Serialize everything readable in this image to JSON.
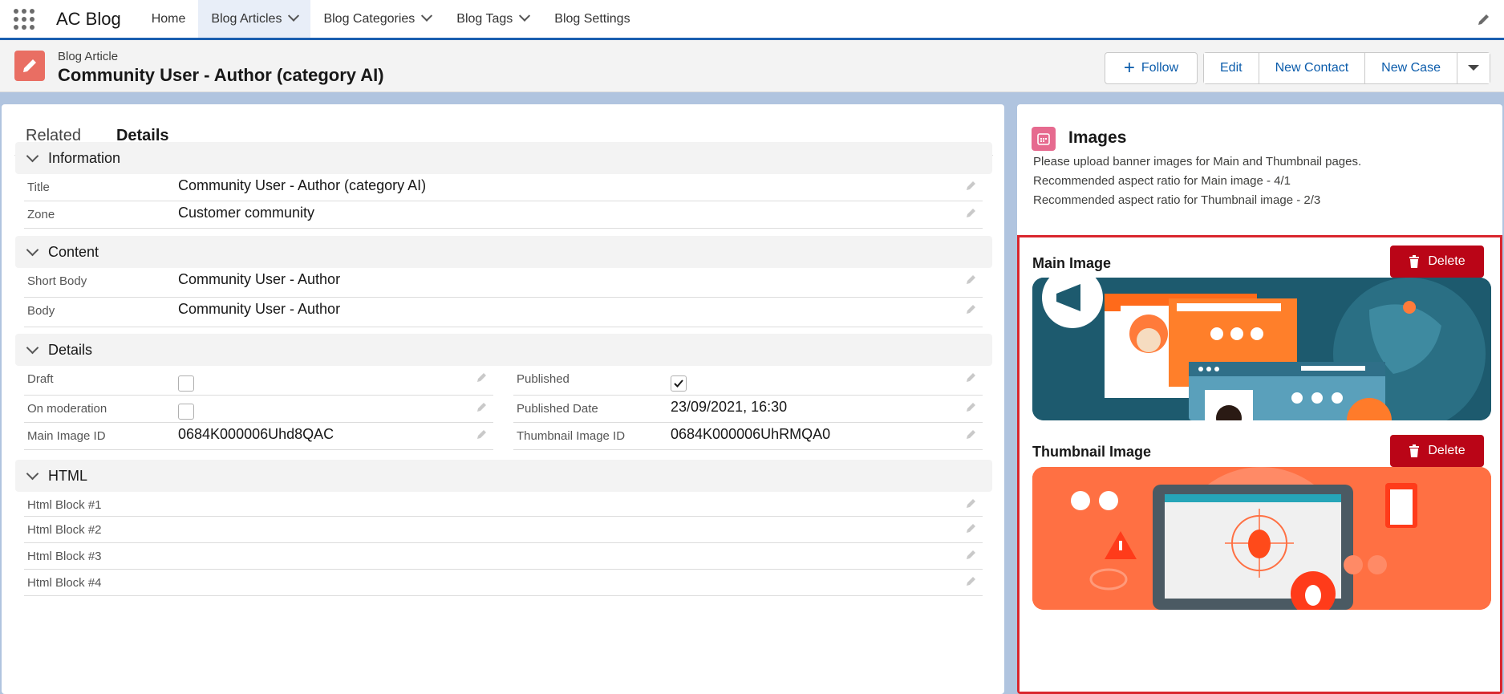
{
  "nav": {
    "app_name": "AC Blog",
    "items": [
      {
        "label": "Home",
        "has_dropdown": false,
        "active": false
      },
      {
        "label": "Blog Articles",
        "has_dropdown": true,
        "active": true
      },
      {
        "label": "Blog Categories",
        "has_dropdown": true,
        "active": false
      },
      {
        "label": "Blog Tags",
        "has_dropdown": true,
        "active": false
      },
      {
        "label": "Blog Settings",
        "has_dropdown": false,
        "active": false
      }
    ]
  },
  "record": {
    "type": "Blog Article",
    "title": "Community User - Author (category AI)",
    "icon": "pencil-icon",
    "follow_label": "Follow",
    "actions": [
      "Edit",
      "New Contact",
      "New Case"
    ]
  },
  "tabs": [
    "Related",
    "Details"
  ],
  "sections": {
    "information": {
      "title": "Information",
      "fields": [
        {
          "label": "Title",
          "value": "Community User - Author (category AI)"
        },
        {
          "label": "Zone",
          "value": "Customer community"
        }
      ]
    },
    "content": {
      "title": "Content",
      "fields": [
        {
          "label": "Short Body",
          "value": "Community User - Author"
        },
        {
          "label": "Body",
          "value": "Community User - Author"
        }
      ]
    },
    "details": {
      "title": "Details",
      "left": [
        {
          "label": "Draft",
          "checked": false
        },
        {
          "label": "On moderation",
          "checked": false
        },
        {
          "label": "Main Image ID",
          "value": "0684K000006Uhd8QAC"
        }
      ],
      "right": [
        {
          "label": "Published",
          "checked": true
        },
        {
          "label": "Published Date",
          "value": "23/09/2021, 16:30"
        },
        {
          "label": "Thumbnail Image ID",
          "value": "0684K000006UhRMQA0"
        }
      ]
    },
    "html": {
      "title": "HTML",
      "fields": [
        {
          "label": "Html Block #1",
          "value": ""
        },
        {
          "label": "Html Block #2",
          "value": ""
        },
        {
          "label": "Html Block #3",
          "value": ""
        },
        {
          "label": "Html Block #4",
          "value": ""
        }
      ]
    }
  },
  "images_panel": {
    "title": "Images",
    "description": [
      "Please upload banner images for Main and Thumbnail pages.",
      "Recommended aspect ratio for Main image - 4/1",
      "Recommended aspect ratio for Thumbnail image - 2/3"
    ],
    "main_image_label": "Main Image",
    "thumbnail_image_label": "Thumbnail Image",
    "delete_label": "Delete",
    "colors": {
      "delete": "#ba0517",
      "frame": "#d9262e",
      "main_bg": "#1d5a6e",
      "thumb_bg": "#ff7043"
    }
  }
}
